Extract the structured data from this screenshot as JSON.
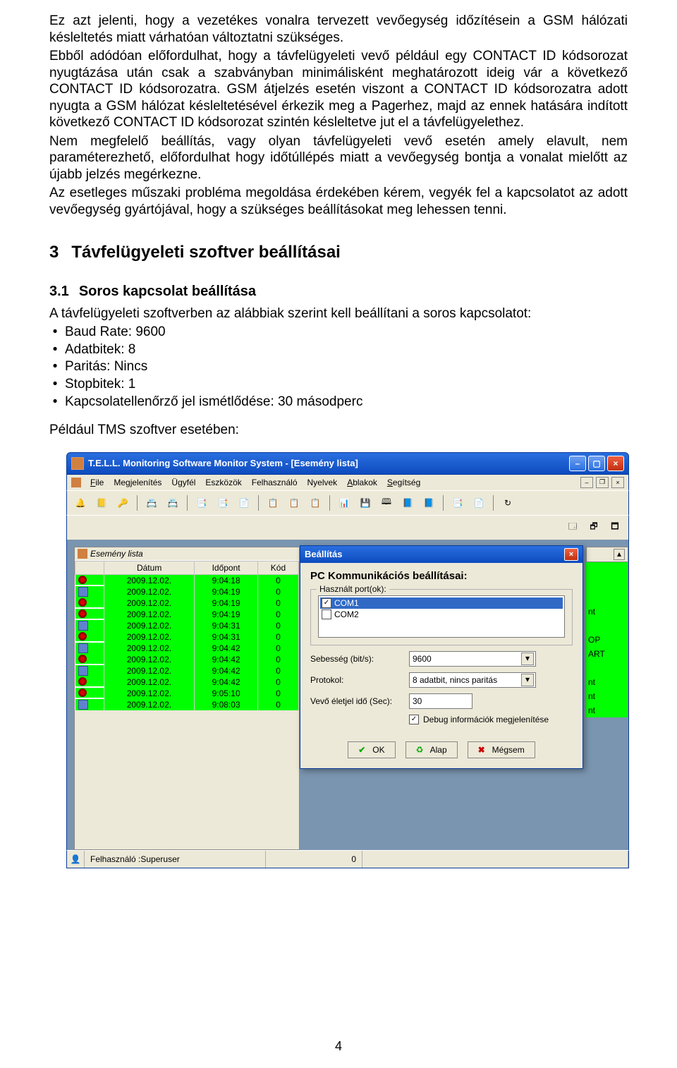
{
  "doc": {
    "p1": "Ez azt jelenti, hogy a vezetékes vonalra tervezett vevőegység időzítésein a GSM hálózati késleltetés miatt várhatóan változtatni szükséges.",
    "p2": "Ebből adódóan előfordulhat, hogy a távfelügyeleti vevő például egy CONTACT ID kódsorozat nyugtázása után csak a szabványban minimálisként meghatározott ideig vár a következő CONTACT ID kódsorozatra. GSM átjelzés esetén viszont a CONTACT ID kódsorozatra adott nyugta a GSM hálózat késleltetésével érkezik meg a Pagerhez, majd az ennek hatására indított következő CONTACT ID kódsorozat szintén késleltetve jut el a távfelügyelethez.",
    "p3": "Nem megfelelő beállítás, vagy olyan távfelügyeleti vevő esetén amely elavult, nem paraméterezhető, előfordulhat hogy időtúllépés miatt a vevőegység bontja a vonalat mielőtt az újabb jelzés megérkezne.",
    "p4": "Az esetleges műszaki probléma megoldása érdekében kérem, vegyék fel a kapcsolatot az adott vevőegység gyártójával, hogy a szükséges beállításokat meg lehessen tenni.",
    "h1_num": "3",
    "h1_txt": "Távfelügyeleti szoftver beállításai",
    "h2_num": "3.1",
    "h2_txt": "Soros kapcsolat beállítása",
    "intro": "A távfelügyeleti szoftverben az alábbiak szerint kell beállítani a soros kapcsolatot:",
    "bullets": [
      "Baud Rate: 9600",
      "Adatbitek: 8",
      "Paritás: Nincs",
      "Stopbitek: 1",
      "Kapcsolatellenőrző jel ismétlődése: 30 másodperc"
    ],
    "example": "Például TMS szoftver esetében:",
    "pagenum": "4"
  },
  "app": {
    "title": "T.E.L.L. Monitoring Software Monitor System - [Esemény lista]",
    "menu": [
      "File",
      "Megjelenítés",
      "Ügyfél",
      "Eszközök",
      "Felhasználó",
      "Nyelvek",
      "Ablakok",
      "Segítség"
    ],
    "listpanel_title": "Esemény lista",
    "columns": [
      "Dátum",
      "Időpont",
      "Kód"
    ],
    "rows": [
      {
        "i": "a",
        "d": "2009.12.02.",
        "t": "9:04:18",
        "k": "0"
      },
      {
        "i": "b",
        "d": "2009.12.02.",
        "t": "9:04:19",
        "k": "0"
      },
      {
        "i": "a",
        "d": "2009.12.02.",
        "t": "9:04:19",
        "k": "0"
      },
      {
        "i": "a",
        "d": "2009.12.02.",
        "t": "9:04:19",
        "k": "0"
      },
      {
        "i": "b",
        "d": "2009.12.02.",
        "t": "9:04:31",
        "k": "0"
      },
      {
        "i": "a",
        "d": "2009.12.02.",
        "t": "9:04:31",
        "k": "0"
      },
      {
        "i": "b",
        "d": "2009.12.02.",
        "t": "9:04:42",
        "k": "0"
      },
      {
        "i": "a",
        "d": "2009.12.02.",
        "t": "9:04:42",
        "k": "0"
      },
      {
        "i": "b",
        "d": "2009.12.02.",
        "t": "9:04:42",
        "k": "0"
      },
      {
        "i": "a",
        "d": "2009.12.02.",
        "t": "9:04:42",
        "k": "0"
      },
      {
        "i": "a",
        "d": "2009.12.02.",
        "t": "9:05:10",
        "k": "0"
      },
      {
        "i": "b",
        "d": "2009.12.02.",
        "t": "9:08:03",
        "k": "0"
      }
    ],
    "right_labels": [
      "",
      "",
      "",
      "nt",
      "",
      "OP",
      "ART",
      "",
      "nt",
      "nt",
      "nt"
    ],
    "dialog": {
      "title": "Beállítás",
      "heading": "PC Kommunikációs beállításai:",
      "ports_legend": "Használt port(ok):",
      "ports": [
        {
          "label": "COM1",
          "checked": true,
          "selected": true
        },
        {
          "label": "COM2",
          "checked": false,
          "selected": false
        }
      ],
      "speed_label": "Sebesség (bit/s):",
      "speed_value": "9600",
      "proto_label": "Protokol:",
      "proto_value": "8 adatbit, nincs paritás",
      "life_label": "Vevő életjel idő (Sec):",
      "life_value": "30",
      "debug_label": "Debug információk megjelenítése",
      "debug_checked": true,
      "btn_ok": "OK",
      "btn_reset": "Alap",
      "btn_cancel": "Mégsem"
    },
    "status_user": "Felhasználó :Superuser",
    "status_zero": "0"
  }
}
